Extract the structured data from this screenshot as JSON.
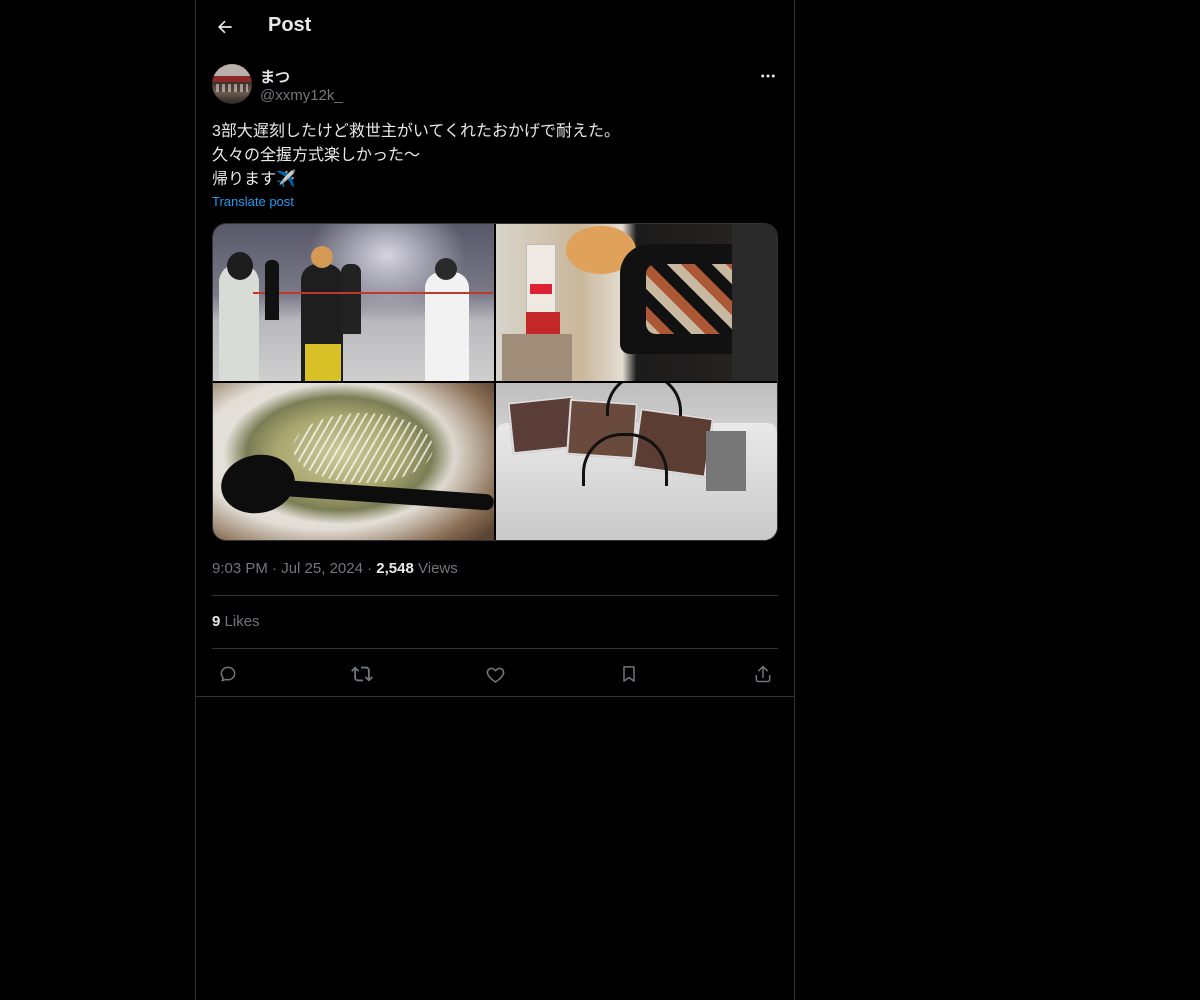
{
  "header": {
    "title": "Post",
    "back_icon": "arrow-left-icon"
  },
  "author": {
    "display_name": "まつ",
    "handle": "@xxmy12k_"
  },
  "post": {
    "lines": [
      "3部大遅刻したけど救世主がいてくれたおかげで耐えた。",
      "久々の全握方式楽しかった〜",
      "帰ります✈️"
    ],
    "translate_label": "Translate post"
  },
  "meta": {
    "time": "9:03 PM",
    "separator": "·",
    "date": "Jul 25, 2024",
    "views_count": "2,548",
    "views_label": "Views"
  },
  "stats": {
    "likes_count": "9",
    "likes_label": "Likes"
  },
  "actions": [
    {
      "name": "reply",
      "icon": "reply-icon"
    },
    {
      "name": "repost",
      "icon": "repost-icon"
    },
    {
      "name": "like",
      "icon": "heart-icon"
    },
    {
      "name": "bookmark",
      "icon": "bookmark-icon"
    },
    {
      "name": "share",
      "icon": "share-icon"
    }
  ],
  "colors": {
    "background": "#000000",
    "text": "#e7e9ea",
    "secondary_text": "#71767b",
    "link": "#1d9bf0",
    "border": "#2f3336"
  }
}
